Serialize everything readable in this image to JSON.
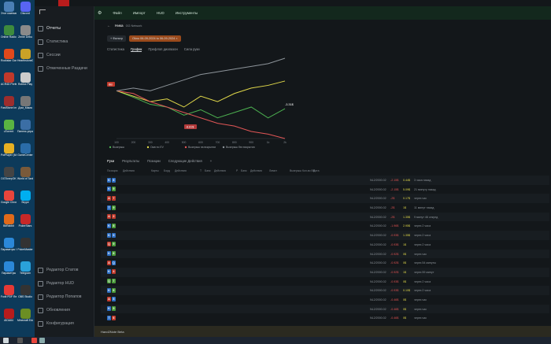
{
  "desktop_icons": [
    {
      "label": "Этот компьютер",
      "color": "#4a7fb5"
    },
    {
      "label": "Discord",
      "color": "#5865f2"
    },
    {
      "label": "Online Radio автор.",
      "color": "#3d8b3d"
    },
    {
      "label": "Zeme Debu",
      "color": "#8a8a8a"
    },
    {
      "label": "Rockstar Games Launcher",
      "color": "#e0491c"
    },
    {
      "label": "HearthstoneDeck",
      "color": "#c9a227"
    },
    {
      "label": "ACR4D Perfekt",
      "color": "#c0392b"
    },
    {
      "label": "Roblox Play",
      "color": "#cccccc"
    },
    {
      "label": "FastStone Image Viewer",
      "color": "#9b2d2d"
    },
    {
      "label": "Дом_Мама",
      "color": "#777777"
    },
    {
      "label": "uTorrent",
      "color": "#59b342"
    },
    {
      "label": "Панель управления",
      "color": "#3b6ea5"
    },
    {
      "label": "PotPlayer (64-bit)",
      "color": "#e6b022"
    },
    {
      "label": "GameCenter",
      "color": "#2a6ca8"
    },
    {
      "label": "DGTonepOK",
      "color": "#444444"
    },
    {
      "label": "World of Tanks EU",
      "color": "#7a5a3a"
    },
    {
      "label": "Google Chrome",
      "color": "#e8453c"
    },
    {
      "label": "Skype",
      "color": "#00aff0"
    },
    {
      "label": "BitRabbit",
      "color": "#e06a1a"
    },
    {
      "label": "PokerStars",
      "color": "#c62828"
    },
    {
      "label": "Параметры Windows",
      "color": "#2b88d8"
    },
    {
      "label": "PokerMaster",
      "color": "#333333"
    },
    {
      "label": "Параметры",
      "color": "#2b88d8"
    },
    {
      "label": "Telegram",
      "color": "#2aa1da"
    },
    {
      "label": "Foxit PDF Reader",
      "color": "#e53935"
    },
    {
      "label": "OBS Studio",
      "color": "#333333"
    },
    {
      "label": "AIDA64",
      "color": "#b71c1c"
    },
    {
      "label": "Minecraft Education",
      "color": "#6b8e23"
    }
  ],
  "sidebar": {
    "items": [
      {
        "label": "Отчеты",
        "active": true
      },
      {
        "label": "Статистика",
        "active": false
      },
      {
        "label": "Сессии",
        "active": false
      },
      {
        "label": "Отмеченные Раздачи",
        "active": false
      }
    ],
    "bottom_items": [
      {
        "label": "Редактор Статов"
      },
      {
        "label": "Редактор HUD"
      },
      {
        "label": "Редактор Попапов"
      },
      {
        "label": "Обновления"
      },
      {
        "label": "Конфигурация"
      }
    ]
  },
  "menu": [
    "Файл",
    "Импорт",
    "HUD",
    "Инструменты"
  ],
  "title": {
    "name": "Ника",
    "sub": "GG Network"
  },
  "filters": {
    "filter_label": "Фильтр",
    "date_range": "Okno 06-09-2024 to 06-09-2024"
  },
  "view_tabs": [
    "Статистика",
    "График",
    "Префлоп диапазон",
    "Сила руки"
  ],
  "chart_data": {
    "type": "line",
    "xlabel": "",
    "ylabel": "",
    "x_ticks": [
      "100",
      "200",
      "300",
      "400",
      "500",
      "600",
      "700",
      "800",
      "900",
      "1k",
      "2k"
    ],
    "xlim": [
      0,
      2000
    ],
    "annotations": [
      "BB",
      "-8.81$",
      "-3.31$",
      "2k"
    ],
    "series": [
      {
        "name": "Выигрыш",
        "color": "#4caf50",
        "values": [
          0,
          -1.2,
          -2.5,
          -3,
          -4.5,
          -3.5,
          -5,
          -4,
          -3,
          -5,
          -3.31
        ]
      },
      {
        "name": "Ожв по EV",
        "color": "#e0d84a",
        "values": [
          0,
          -1,
          -2,
          -1.5,
          -3,
          -1,
          -2,
          -0.5,
          0.5,
          1,
          1.8
        ]
      },
      {
        "name": "Выигрыш на вскрытии",
        "color": "#e15656",
        "values": [
          0,
          -0.5,
          -2,
          -3,
          -4,
          -5,
          -6,
          -6.5,
          -7.5,
          -8,
          -8.81
        ]
      },
      {
        "name": "Выигрыш без вскрытия",
        "color": "#8d949a",
        "values": [
          0,
          0.5,
          0,
          1,
          2,
          3,
          3.5,
          4,
          4.5,
          5,
          6
        ]
      }
    ]
  },
  "hand_tabs": [
    "Руки",
    "Результаты",
    "Позиции",
    "Следующие Действия",
    "+"
  ],
  "table_headers": [
    "Позиция",
    "Действия",
    "Карты",
    "Борд",
    "Действия",
    "Т",
    "Банк",
    "Действия",
    "Р",
    "Банк",
    "Действия",
    "Лимит",
    "Выигрыш",
    "Кол-во BB",
    "Дата"
  ],
  "hands": [
    {
      "cards": [
        "K",
        "6"
      ],
      "suits": [
        "#2e6fc4",
        "#2e6fc4"
      ],
      "limit": "NL2/2000.02",
      "won": "-2.15$",
      "bb": "0.44$",
      "date": "3 часа назад"
    },
    {
      "cards": [
        "K",
        "9"
      ],
      "suits": [
        "#2e6fc4",
        "#4a9a3a"
      ],
      "limit": "NL2/2000.02",
      "won": "-2.15$",
      "bb": "5.09$",
      "date": "21 минуту назад"
    },
    {
      "cards": [
        "A",
        "7"
      ],
      "suits": [
        "#c0392b",
        "#c0392b"
      ],
      "limit": "NL2/2000.02",
      "won": "-2$",
      "bb": "0.17$",
      "date": "через час"
    },
    {
      "cards": [
        "T",
        "9"
      ],
      "suits": [
        "#2e6fc4",
        "#4a9a3a"
      ],
      "limit": "NL2/2000.02",
      "won": "-2$",
      "bb": "1$",
      "date": "11 минут назад"
    },
    {
      "cards": [
        "A",
        "2"
      ],
      "suits": [
        "#c0392b",
        "#c0392b"
      ],
      "limit": "NL2/2000.02",
      "won": "-2$",
      "bb": "1.35$",
      "date": "9 минут 46 секунд"
    },
    {
      "cards": [
        "K",
        "8"
      ],
      "suits": [
        "#2e6fc4",
        "#4a9a3a"
      ],
      "limit": "NL2/2000.02",
      "won": "-1.96$",
      "bb": "2.95$",
      "date": "через 2 часа"
    },
    {
      "cards": [
        "K",
        "9"
      ],
      "suits": [
        "#2e6fc4",
        "#2e6fc4"
      ],
      "limit": "NL2/2000.02",
      "won": "-0.93$",
      "bb": "1.35$",
      "date": "через 2 часа"
    },
    {
      "cards": [
        "Q",
        "9"
      ],
      "suits": [
        "#c0392b",
        "#4a9a3a"
      ],
      "limit": "NL2/2000.02",
      "won": "-0.93$",
      "bb": "1$",
      "date": "через 2 часа"
    },
    {
      "cards": [
        "K",
        "6"
      ],
      "suits": [
        "#2e6fc4",
        "#4a9a3a"
      ],
      "limit": "NL2/2000.02",
      "won": "-0.92$",
      "bb": "0$",
      "date": "через час"
    },
    {
      "cards": [
        "A",
        "Q"
      ],
      "suits": [
        "#c0392b",
        "#2e6fc4"
      ],
      "limit": "NL2/2000.02",
      "won": "-0.92$",
      "bb": "0$",
      "date": "через 54 минуты"
    },
    {
      "cards": [
        "K",
        "4"
      ],
      "suits": [
        "#2e6fc4",
        "#c0392b"
      ],
      "limit": "NL2/2000.02",
      "won": "-0.92$",
      "bb": "1$",
      "date": "через 59 минут"
    },
    {
      "cards": [
        "Q",
        "7"
      ],
      "suits": [
        "#4a9a3a",
        "#4a9a3a"
      ],
      "limit": "NL2/2000.02",
      "won": "-0.93$",
      "bb": "0$",
      "date": "через 2 часа"
    },
    {
      "cards": [
        "K",
        "6"
      ],
      "suits": [
        "#2e6fc4",
        "#4a9a3a"
      ],
      "limit": "NL2/2000.02",
      "won": "-0.93$",
      "bb": "0.10$",
      "date": "через 2 часа"
    },
    {
      "cards": [
        "A",
        "5"
      ],
      "suits": [
        "#c0392b",
        "#2e6fc4"
      ],
      "limit": "NL2/2000.02",
      "won": "-0.46$",
      "bb": "0$",
      "date": "через час"
    },
    {
      "cards": [
        "K",
        "5"
      ],
      "suits": [
        "#2e6fc4",
        "#4a9a3a"
      ],
      "limit": "NL2/2000.02",
      "won": "-0.46$",
      "bb": "0$",
      "date": "через час"
    },
    {
      "cards": [
        "T",
        "6"
      ],
      "suits": [
        "#2e6fc4",
        "#c0392b"
      ],
      "limit": "NL2/2000.02",
      "won": "-0.46$",
      "bb": "0$",
      "date": "через час"
    }
  ],
  "footer": "Hand2Note Beta"
}
